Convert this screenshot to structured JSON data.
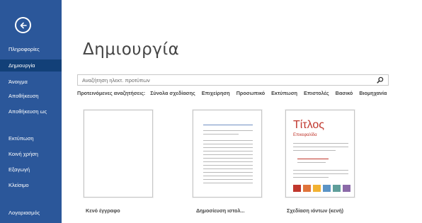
{
  "sidebar": {
    "items": [
      {
        "label": "Πληροφορίες"
      },
      {
        "label": "Δημιουργία"
      },
      {
        "label": "Άνοιγμα"
      },
      {
        "label": "Αποθήκευση"
      },
      {
        "label": "Αποθήκευση ως"
      },
      {
        "label": "Εκτύπωση"
      },
      {
        "label": "Κοινή χρήση"
      },
      {
        "label": "Εξαγωγή"
      },
      {
        "label": "Κλείσιμο"
      },
      {
        "label": "Λογαριασμός"
      }
    ],
    "active_index": 1,
    "back_icon": "back-arrow-icon",
    "background_color": "#2b579a",
    "active_color": "#124078"
  },
  "main": {
    "title": "Δημιουργία",
    "search": {
      "placeholder": "Αναζήτηση ηλεκτ. προτύπων",
      "value": "",
      "icon": "search-icon"
    },
    "suggested": {
      "label": "Προτεινόμενες αναζητήσεις:",
      "tags": [
        "Σύνολα σχεδίασης",
        "Επιχείρηση",
        "Προσωπικό",
        "Εκτύπωση",
        "Επιστολές",
        "Βασικό",
        "Βιομηχανία"
      ]
    },
    "templates": [
      {
        "label": "Κενό έγγραφο"
      },
      {
        "label": "Δημοσίευση ιστολ..."
      },
      {
        "label": "Σχεδίαση ιόντων (κενή)",
        "thumb_title": "Τίτλος",
        "thumb_subtitle": "Επικεφαλίδα"
      }
    ],
    "swatch_colors": [
      "#c0372d",
      "#e0743b",
      "#f2b233",
      "#5b94c6",
      "#5f9e9a",
      "#8b6aa8"
    ]
  }
}
